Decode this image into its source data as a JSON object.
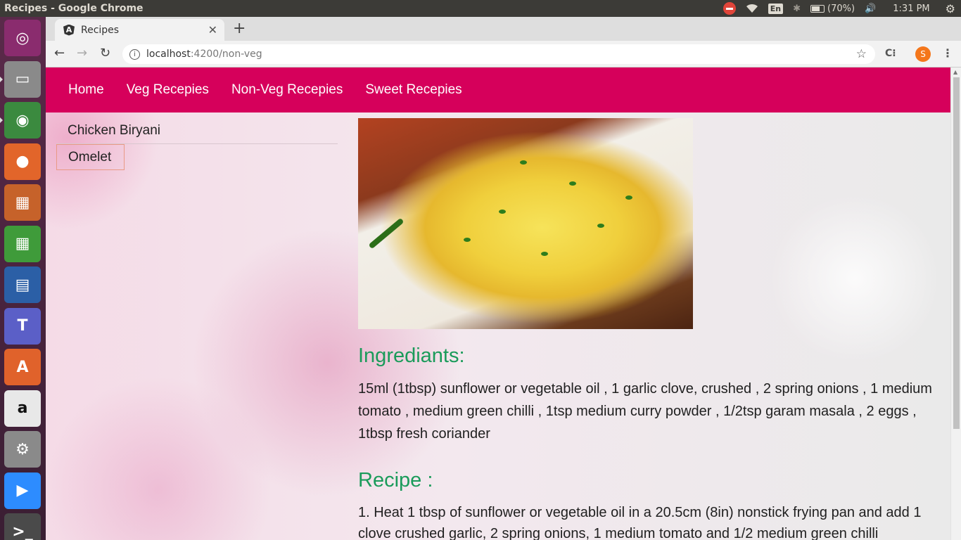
{
  "os": {
    "window_title": "Recipes - Google Chrome",
    "tray": {
      "lang": "En",
      "battery_text": "(70%)",
      "battery_level": 0.7,
      "clock": "1:31 PM"
    }
  },
  "launcher": [
    {
      "name": "ubuntu-icon",
      "color": "#8a2c6e",
      "glyph": "◎"
    },
    {
      "name": "files-icon",
      "color": "#8a8a8a",
      "glyph": "▭"
    },
    {
      "name": "chrome-icon",
      "color": "#3b8a3f",
      "glyph": "◉"
    },
    {
      "name": "firefox-icon",
      "color": "#e2652a",
      "glyph": "●"
    },
    {
      "name": "impress-icon",
      "color": "#c6622a",
      "glyph": "▦"
    },
    {
      "name": "calc-icon",
      "color": "#3f9b3a",
      "glyph": "▦"
    },
    {
      "name": "writer-icon",
      "color": "#2b5fa6",
      "glyph": "▤"
    },
    {
      "name": "teams-icon",
      "color": "#5b5fc7",
      "glyph": "T"
    },
    {
      "name": "software-icon",
      "color": "#e0622b",
      "glyph": "A"
    },
    {
      "name": "amazon-icon",
      "color": "#e8e8e8",
      "glyph": "a"
    },
    {
      "name": "settings-icon",
      "color": "#8a8a8a",
      "glyph": "⚙"
    },
    {
      "name": "zoom-icon",
      "color": "#2d8cff",
      "glyph": "▶"
    },
    {
      "name": "terminal-icon",
      "color": "#4a4a4a",
      "glyph": ">_"
    }
  ],
  "browser": {
    "tab_title": "Recipes",
    "url_host": "localhost",
    "url_path": ":4200/non-veg",
    "avatar_letter": "S"
  },
  "page": {
    "nav": [
      "Home",
      "Veg Recepies",
      "Non-Veg Recepies",
      "Sweet Recepies"
    ],
    "sidebar": [
      "Chicken Biryani",
      "Omelet"
    ],
    "selected": "Omelet",
    "ingredients_heading": "Ingrediants:",
    "ingredients_text": "15ml (1tbsp) sunflower or vegetable oil , 1 garlic clove, crushed , 2 spring onions , 1 medium tomato , medium green chilli , 1tsp medium curry powder , 1/2tsp garam masala , 2 eggs , 1tbsp fresh coriander",
    "recipe_heading": "Recipe :",
    "recipe_text": "1. Heat 1 tbsp of sunflower or vegetable oil in a 20.5cm (8in) nonstick frying pan and add 1 clove crushed garlic, 2 spring onions, 1 medium tomato and 1/2 medium green chilli"
  },
  "colors": {
    "nav_bg": "#d6005b",
    "heading_green": "#1a9b5a",
    "selected_border": "#e99a86"
  }
}
